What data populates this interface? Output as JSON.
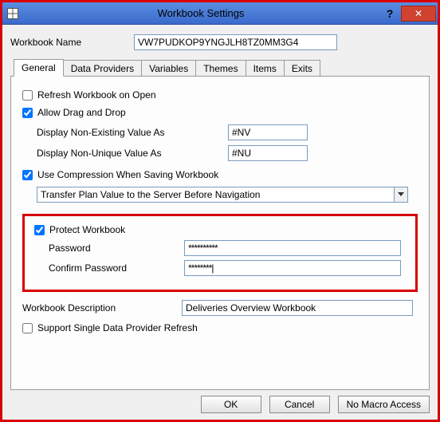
{
  "window": {
    "title": "Workbook Settings",
    "help": "?",
    "close": "✕"
  },
  "form": {
    "workbook_name_label": "Workbook Name",
    "workbook_name_value": "VW7PUDKOP9YNGJLH8TZ0MM3G4"
  },
  "tabs": {
    "general": "General",
    "data_providers": "Data Providers",
    "variables": "Variables",
    "themes": "Themes",
    "items": "Items",
    "exits": "Exits"
  },
  "general": {
    "refresh_label": "Refresh Workbook on Open",
    "allow_drag_label": "Allow Drag and Drop",
    "nonexisting_label": "Display Non-Existing Value As",
    "nonexisting_value": "#NV",
    "nonunique_label": "Display Non-Unique Value As",
    "nonunique_value": "#NU",
    "compression_label": "Use Compression When Saving Workbook",
    "combo_value": "Transfer Plan Value to the Server Before Navigation",
    "protect_label": "Protect Workbook",
    "password_label": "Password",
    "password_value": "**********",
    "confirm_label": "Confirm Password",
    "confirm_value": "********|",
    "description_label": "Workbook Description",
    "description_value": "Deliveries Overview Workbook",
    "support_single_label": "Support Single Data Provider Refresh"
  },
  "buttons": {
    "ok": "OK",
    "cancel": "Cancel",
    "no_macro": "No Macro Access"
  }
}
